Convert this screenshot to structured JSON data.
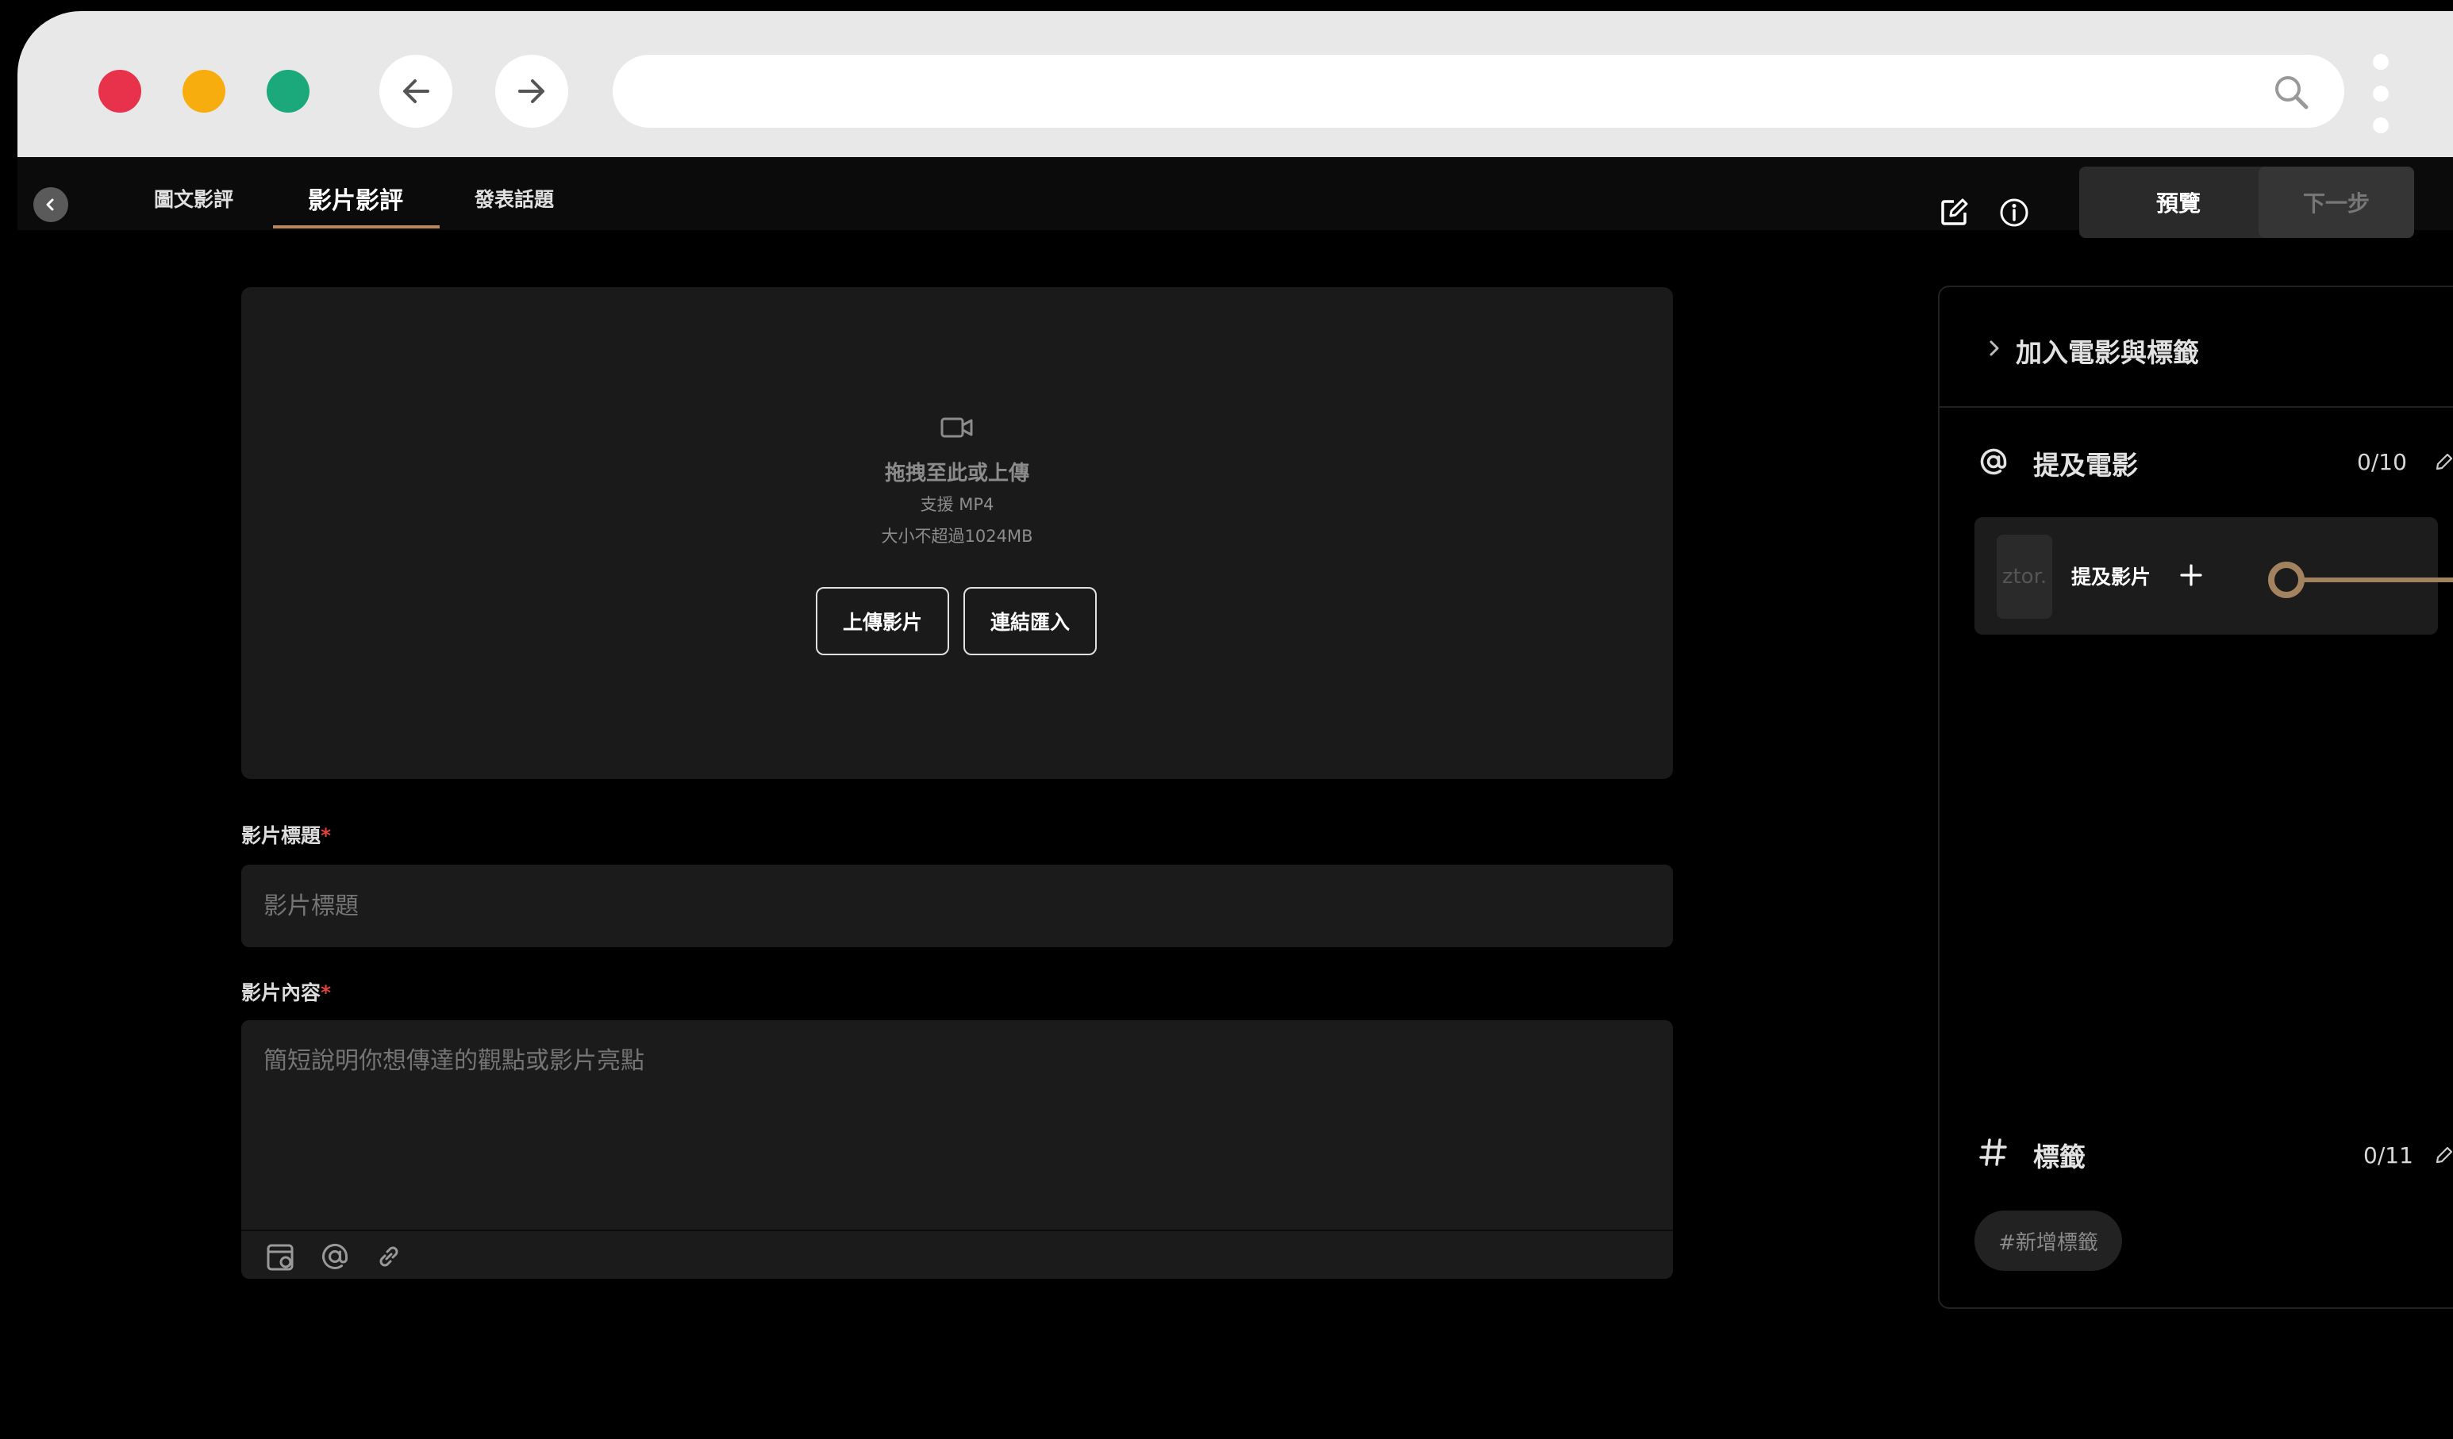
{
  "colors": {
    "close": "#e8314b",
    "minimize": "#f7ad0e",
    "maximize": "#1ba87a",
    "accent": "#b9875f",
    "slider": "#a3825f",
    "required": "#e0433c"
  },
  "tabs": [
    {
      "label": "圖文影評",
      "active": false
    },
    {
      "label": "影片影評",
      "active": true
    },
    {
      "label": "發表話題",
      "active": false
    }
  ],
  "toolbar": {
    "preview_label": "預覽",
    "next_label": "下一步"
  },
  "upload": {
    "drag_text": "拖拽至此或上傳",
    "format_text": "支援 MP4",
    "size_text": "大小不超過1024MB",
    "upload_btn": "上傳影片",
    "link_btn": "連結匯入"
  },
  "form": {
    "title_label": "影片標題",
    "title_placeholder": "影片標題",
    "content_label": "影片內容",
    "content_placeholder": "簡短說明你想傳達的觀點或影片亮點",
    "required_mark": "*"
  },
  "panel": {
    "section_title": "加入電影與標籤",
    "mention": {
      "title": "提及電影",
      "count": "0/10",
      "card_label": "提及影片",
      "thumb_text": "ztor."
    },
    "tags": {
      "title": "標籤",
      "count": "0/11",
      "add_label": "#新增標籤"
    }
  }
}
